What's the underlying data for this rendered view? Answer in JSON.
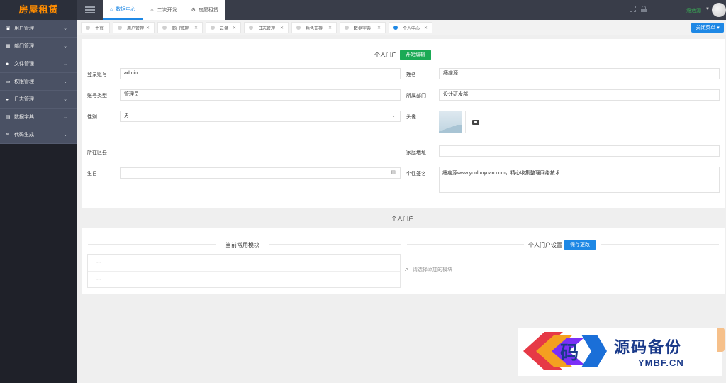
{
  "app": {
    "logo": "房屋租赁"
  },
  "top_nav": [
    {
      "label": "数据中心",
      "icon": "home-icon"
    },
    {
      "label": "二次开发",
      "icon": "bulb-icon"
    },
    {
      "label": "房屋租赁",
      "icon": "gear-icon"
    }
  ],
  "user": {
    "name": "瘾痞源"
  },
  "sidebar": {
    "items": [
      {
        "label": "用户管理",
        "icon": "user-icon"
      },
      {
        "label": "部门管理",
        "icon": "grid-icon"
      },
      {
        "label": "文件管理",
        "icon": "file-icon"
      },
      {
        "label": "权限管理",
        "icon": "monitor-icon"
      },
      {
        "label": "日志管理",
        "icon": "log-icon"
      },
      {
        "label": "数据字典",
        "icon": "dict-icon"
      },
      {
        "label": "代码生成",
        "icon": "code-icon"
      }
    ]
  },
  "tabs": [
    {
      "label": "主页"
    },
    {
      "label": "用户管理"
    },
    {
      "label": "部门管理"
    },
    {
      "label": "云盘"
    },
    {
      "label": "日志管理"
    },
    {
      "label": "角色支持"
    },
    {
      "label": "数据字典"
    },
    {
      "label": "个人中心"
    }
  ],
  "close_menu": "关闭菜单",
  "profile": {
    "title": "个人门户",
    "edit_button": "开始编辑",
    "labels": {
      "account": "登录账号",
      "name": "姓名",
      "account_type": "账号类型",
      "department": "所属部门",
      "gender": "性别",
      "avatar": "头像",
      "region": "所在区县",
      "address": "家庭地址",
      "birthday": "生日",
      "signature": "个性签名"
    },
    "values": {
      "account": "admin",
      "name": "瘾痞源",
      "account_type": "管理员",
      "department": "设计研发部",
      "gender": "男",
      "address": "",
      "birthday": "",
      "signature": "瘾痞源www.youluoyuan.com，精心收集整理网络技术"
    }
  },
  "portal": {
    "heading": "个人门户",
    "current_modules_title": "当前常用模块",
    "modules": [
      "---",
      "---"
    ],
    "settings_title": "个人门户设置",
    "save_button": "保存更改",
    "search_placeholder": "请选择添加的模块"
  },
  "watermark": {
    "logo_char": "码",
    "cn": "源码备份",
    "en": "YMBF.CN"
  },
  "colors": {
    "accent": "#1e88e5",
    "green": "#1aaa55",
    "logo": "#ff8c00",
    "sidebar": "#4a5164",
    "topbar": "#393d49"
  }
}
